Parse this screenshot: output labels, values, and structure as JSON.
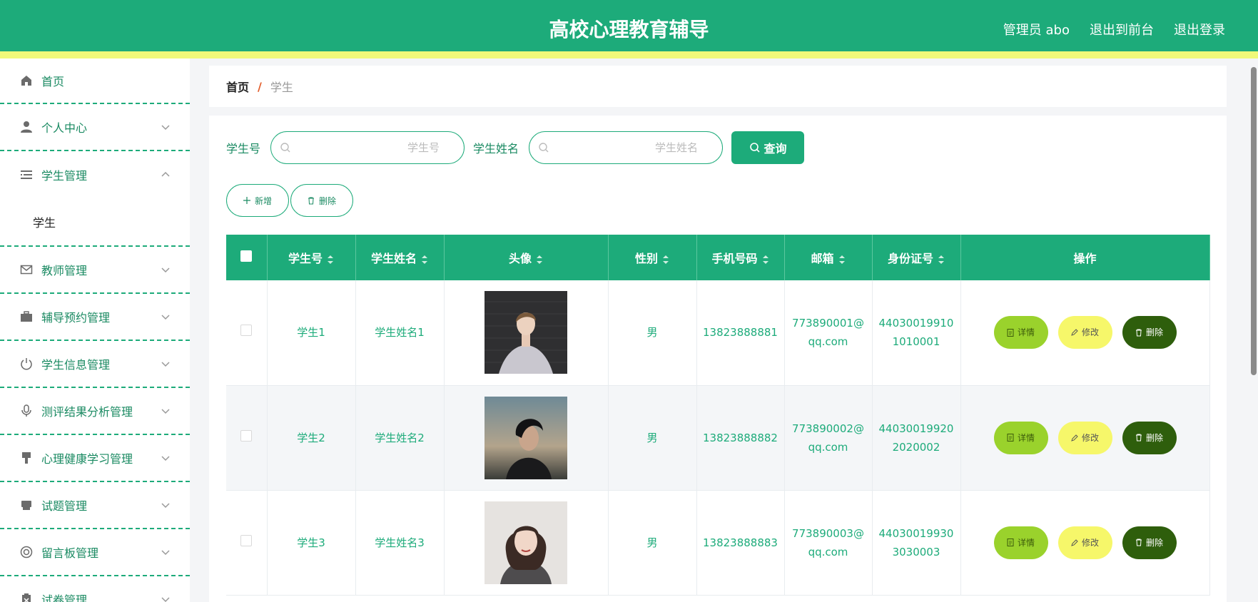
{
  "header": {
    "title": "高校心理教育辅导",
    "admin_label": "管理员 abo",
    "to_front": "退出到前台",
    "logout": "退出登录"
  },
  "sidebar": {
    "items": [
      {
        "label": "首页",
        "icon": "home-icon"
      },
      {
        "label": "个人中心",
        "icon": "user-icon"
      },
      {
        "label": "学生管理",
        "icon": "list-icon",
        "expanded": true,
        "children": [
          "学生"
        ]
      },
      {
        "label": "教师管理",
        "icon": "mail-icon"
      },
      {
        "label": "辅导预约管理",
        "icon": "briefcase-icon"
      },
      {
        "label": "学生信息管理",
        "icon": "power-icon"
      },
      {
        "label": "测评结果分析管理",
        "icon": "microphone-icon"
      },
      {
        "label": "心理健康学习管理",
        "icon": "brush-icon"
      },
      {
        "label": "试题管理",
        "icon": "printer-icon"
      },
      {
        "label": "留言板管理",
        "icon": "lifebuoy-icon"
      },
      {
        "label": "试卷管理",
        "icon": "clipboard-icon"
      }
    ]
  },
  "breadcrumb": {
    "home": "首页",
    "sep": "/",
    "current": "学生"
  },
  "search": {
    "student_no_label": "学生号",
    "student_no_placeholder": "学生号",
    "student_name_label": "学生姓名",
    "student_name_placeholder": "学生姓名",
    "query_button": "查询"
  },
  "actions": {
    "add": "新增",
    "delete": "删除"
  },
  "table": {
    "columns": [
      "学生号",
      "学生姓名",
      "头像",
      "性别",
      "手机号码",
      "邮箱",
      "身份证号",
      "操作"
    ],
    "rows": [
      {
        "no": "学生1",
        "name": "学生姓名1",
        "gender": "男",
        "phone": "13823888881",
        "email_1": "773890001@",
        "email_2": "qq.com",
        "id_1": "44030019910",
        "id_2": "1010001"
      },
      {
        "no": "学生2",
        "name": "学生姓名2",
        "gender": "男",
        "phone": "13823888882",
        "email_1": "773890002@",
        "email_2": "qq.com",
        "id_1": "44030019920",
        "id_2": "2020002"
      },
      {
        "no": "学生3",
        "name": "学生姓名3",
        "gender": "男",
        "phone": "13823888883",
        "email_1": "773890003@",
        "email_2": "qq.com",
        "id_1": "44030019930",
        "id_2": "3030003"
      }
    ],
    "ops": {
      "detail": "详情",
      "edit": "修改",
      "delete": "删除"
    }
  },
  "colors": {
    "primary": "#1dab7a",
    "accent_strip": "#f0f97a",
    "detail": "#9ad22c",
    "edit": "#f6f76a",
    "delete": "#2e5e0c"
  }
}
